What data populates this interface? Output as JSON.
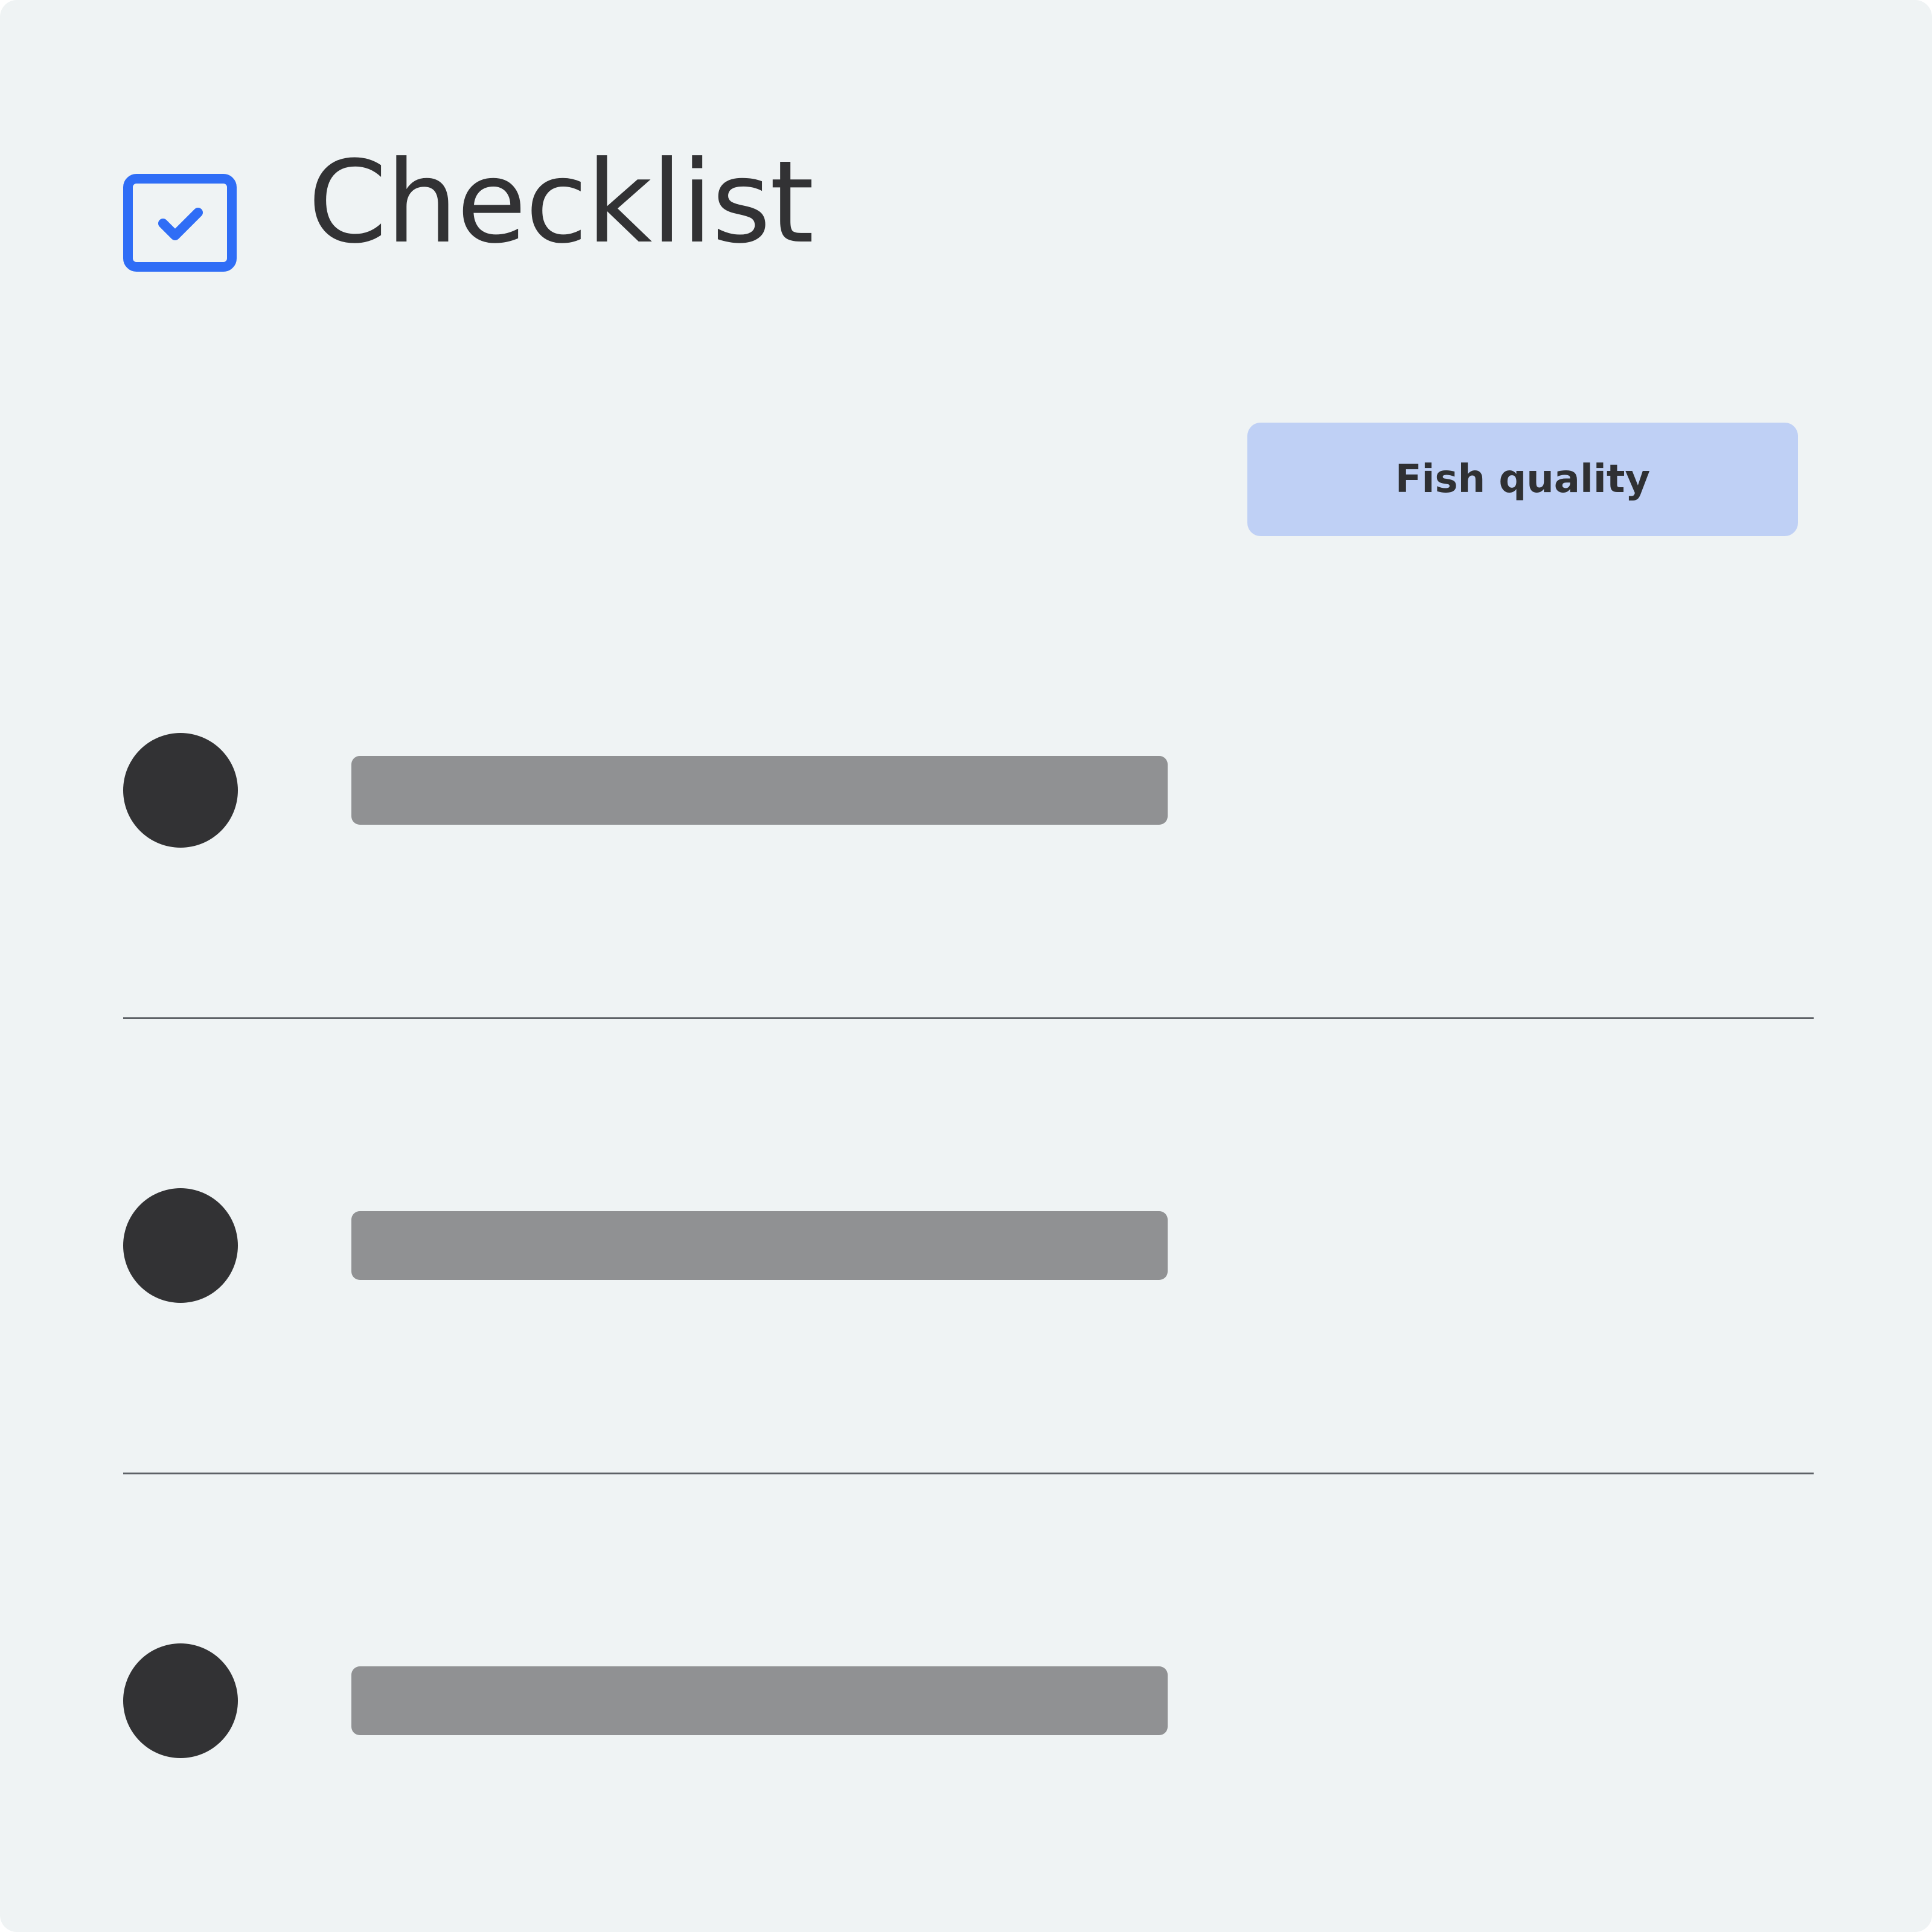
{
  "header": {
    "title": "Checklist",
    "icon": "checkbox-checked-icon",
    "icon_color": "#2f6df6"
  },
  "tag": {
    "label": "Fish quality",
    "background": "#bfd0f5"
  },
  "list": {
    "items": [
      {
        "bullet_icon": "bullet-dot-icon",
        "text": ""
      },
      {
        "bullet_icon": "bullet-dot-icon",
        "text": ""
      },
      {
        "bullet_icon": "bullet-dot-icon",
        "text": ""
      }
    ]
  },
  "colors": {
    "background": "#eff3f4",
    "text": "#323234",
    "placeholder": "#909193",
    "divider": "#5d6166"
  }
}
